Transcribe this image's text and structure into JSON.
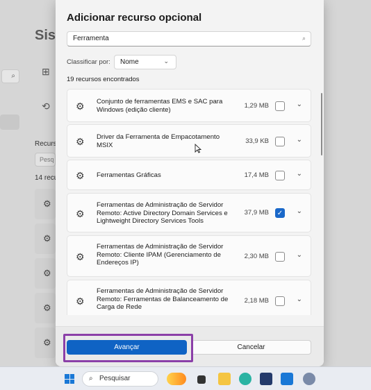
{
  "background": {
    "title": "Sist",
    "section_label": "Recurs",
    "filter_placeholder": "Pesq",
    "count_text": "14 recu"
  },
  "dialog": {
    "title": "Adicionar recurso opcional",
    "search": {
      "value": "Ferramenta"
    },
    "sort": {
      "label": "Classificar por:",
      "value": "Nome"
    },
    "result_count": "19 recursos encontrados",
    "items": [
      {
        "name": "Conjunto de ferramentas EMS e SAC para Windows (edição cliente)",
        "size": "1,29 MB",
        "checked": false
      },
      {
        "name": "Driver da Ferramenta de Empacotamento MSIX",
        "size": "33,9 KB",
        "checked": false
      },
      {
        "name": "Ferramentas Gráficas",
        "size": "17,4 MB",
        "checked": false
      },
      {
        "name": "Ferramentas de Administração de Servidor Remoto: Active Directory Domain Services e Lightweight Directory Services Tools",
        "size": "37,9 MB",
        "checked": true
      },
      {
        "name": "Ferramentas de Administração de Servidor Remoto: Cliente IPAM (Gerenciamento de Endereços IP)",
        "size": "2,30 MB",
        "checked": false
      },
      {
        "name": "Ferramentas de Administração de Servidor Remoto: Ferramentas de Balanceamento de Carga de Rede",
        "size": "2,18 MB",
        "checked": false
      }
    ],
    "buttons": {
      "primary": "Avançar",
      "secondary": "Cancelar"
    }
  },
  "taskbar": {
    "search_placeholder": "Pesquisar"
  },
  "colors": {
    "accent": "#0f63c4",
    "highlight": "#8b3fa8"
  }
}
